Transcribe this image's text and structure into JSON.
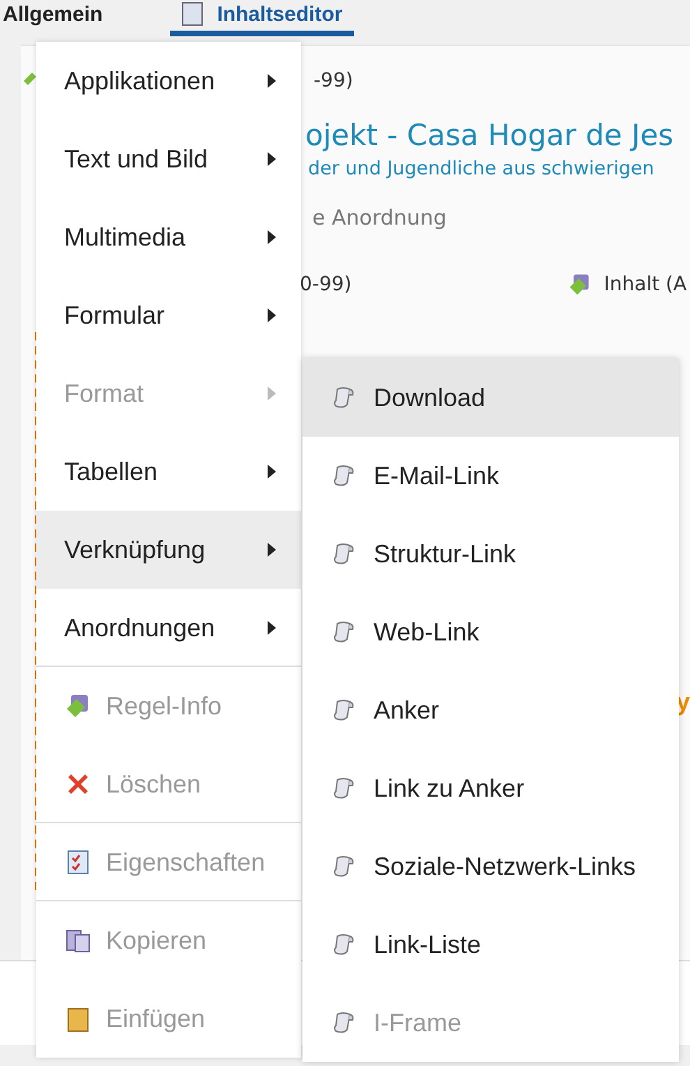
{
  "tabs": [
    {
      "label": "Allgemein",
      "selected": false
    },
    {
      "label": "Inhaltseditor",
      "selected": true
    }
  ],
  "content": {
    "rule_text": "-99)",
    "heading": "ojekt - Casa Hogar de Jes",
    "subheading": "der und Jugendliche aus schwierigen",
    "layout_label": "e Anordnung",
    "cell_1": "0-99)",
    "cell_2": "Inhalt (A",
    "side_fragment": "y"
  },
  "context_menu": {
    "items": [
      {
        "kind": "submenu",
        "label": "Applikationen",
        "disabled": false,
        "highlighted": false
      },
      {
        "kind": "submenu",
        "label": "Text und Bild",
        "disabled": false,
        "highlighted": false
      },
      {
        "kind": "submenu",
        "label": "Multimedia",
        "disabled": false,
        "highlighted": false
      },
      {
        "kind": "submenu",
        "label": "Formular",
        "disabled": false,
        "highlighted": false
      },
      {
        "kind": "submenu",
        "label": "Format",
        "disabled": true,
        "highlighted": false
      },
      {
        "kind": "submenu",
        "label": "Tabellen",
        "disabled": false,
        "highlighted": false
      },
      {
        "kind": "submenu",
        "label": "Verknüpfung",
        "disabled": false,
        "highlighted": true
      },
      {
        "kind": "submenu",
        "label": "Anordnungen",
        "disabled": false,
        "highlighted": false
      },
      {
        "kind": "separator"
      },
      {
        "kind": "action",
        "label": "Regel-Info",
        "disabled": true,
        "highlighted": false
      },
      {
        "kind": "action",
        "label": "Löschen",
        "disabled": true,
        "highlighted": false
      },
      {
        "kind": "separator"
      },
      {
        "kind": "action",
        "label": "Eigenschaften",
        "disabled": true,
        "highlighted": false
      },
      {
        "kind": "separator"
      },
      {
        "kind": "action",
        "label": "Kopieren",
        "disabled": true,
        "highlighted": false
      },
      {
        "kind": "action",
        "label": "Einfügen",
        "disabled": true,
        "highlighted": false
      }
    ]
  },
  "submenu": {
    "items": [
      {
        "label": "Download",
        "disabled": false,
        "highlighted": true
      },
      {
        "label": "E-Mail-Link",
        "disabled": false,
        "highlighted": false
      },
      {
        "label": "Struktur-Link",
        "disabled": false,
        "highlighted": false
      },
      {
        "label": "Web-Link",
        "disabled": false,
        "highlighted": false
      },
      {
        "label": "Anker",
        "disabled": false,
        "highlighted": false
      },
      {
        "label": "Link zu Anker",
        "disabled": false,
        "highlighted": false
      },
      {
        "label": "Soziale-Netzwerk-Links",
        "disabled": false,
        "highlighted": false
      },
      {
        "label": "Link-Liste",
        "disabled": false,
        "highlighted": false
      },
      {
        "label": "I-Frame",
        "disabled": true,
        "highlighted": false
      }
    ]
  }
}
